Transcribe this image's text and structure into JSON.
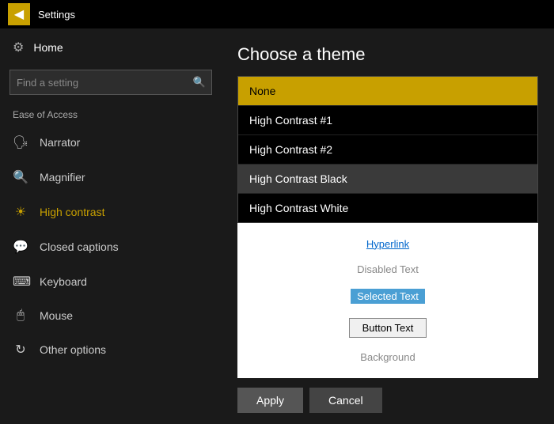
{
  "titleBar": {
    "backIcon": "◀",
    "title": "Settings"
  },
  "sidebar": {
    "home": {
      "icon": "⚙",
      "label": "Home"
    },
    "search": {
      "placeholder": "Find a setting",
      "searchIcon": "🔍"
    },
    "sectionLabel": "Ease of Access",
    "items": [
      {
        "id": "narrator",
        "icon": "💬",
        "label": "Narrator",
        "active": false
      },
      {
        "id": "magnifier",
        "icon": "🔍",
        "label": "Magnifier",
        "active": false
      },
      {
        "id": "high-contrast",
        "icon": "☀",
        "label": "High contrast",
        "active": true
      },
      {
        "id": "closed-captions",
        "icon": "💬",
        "label": "Closed captions",
        "active": false
      },
      {
        "id": "keyboard",
        "icon": "⌨",
        "label": "Keyboard",
        "active": false
      },
      {
        "id": "mouse",
        "icon": "🖱",
        "label": "Mouse",
        "active": false
      },
      {
        "id": "other-options",
        "icon": "🔄",
        "label": "Other options",
        "active": false
      }
    ]
  },
  "content": {
    "title": "Choose a theme",
    "themeOptions": [
      {
        "id": "none",
        "label": "None",
        "selected": true,
        "highlighted": false
      },
      {
        "id": "hc1",
        "label": "High Contrast #1",
        "selected": false,
        "highlighted": false
      },
      {
        "id": "hc2",
        "label": "High Contrast #2",
        "selected": false,
        "highlighted": false
      },
      {
        "id": "hcb",
        "label": "High Contrast Black",
        "selected": false,
        "highlighted": true
      },
      {
        "id": "hcw",
        "label": "High Contrast White",
        "selected": false,
        "highlighted": false
      }
    ],
    "preview": {
      "hyperlinkText": "Hyperlink",
      "disabledText": "Disabled Text",
      "selectedText": "Selected Text",
      "buttonText": "Button Text",
      "backgroundText": "Background"
    },
    "buttons": {
      "apply": "Apply",
      "cancel": "Cancel"
    }
  }
}
